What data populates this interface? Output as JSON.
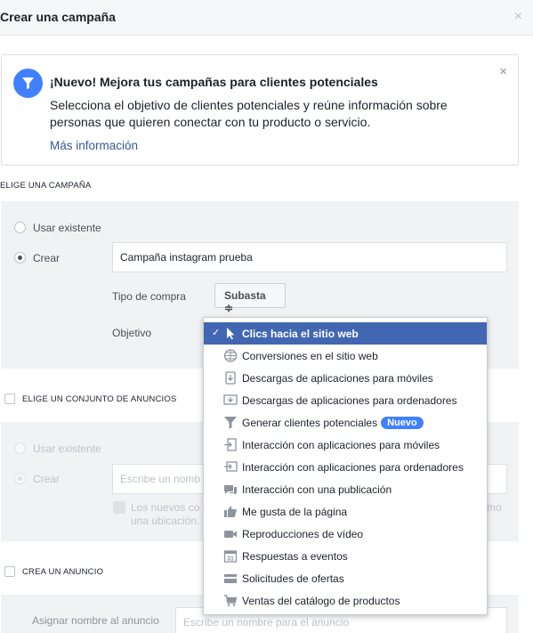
{
  "header": {
    "title": "Crear una campaña",
    "close_glyph": "×"
  },
  "notice": {
    "icon": "filter-icon",
    "title": "¡Nuevo! Mejora tus campañas para clientes potenciales",
    "body_line1": "Selecciona el objetivo de clientes potenciales y reúne información sobre",
    "body_line2": "personas que quieren conectar con tu producto o servicio.",
    "link": "Más información",
    "close_glyph": "×"
  },
  "campaign": {
    "section_label": "ELIGE UNA CAMPAÑA",
    "use_existing": "Usar existente",
    "create": "Crear",
    "name_value": "Campaña instagram prueba",
    "purchase_type_label": "Tipo de compra",
    "purchase_type_value": "Subasta ≑",
    "objective_label": "Objetivo"
  },
  "adset": {
    "section_label": "ELIGE UN CONJUNTO DE ANUNCIOS",
    "use_existing": "Usar existente",
    "create": "Crear",
    "name_placeholder": "Escribe un nomb",
    "note_line1": "Los nuevos co",
    "note_line2": "una ubicación.",
    "note_right": "mo"
  },
  "ad": {
    "section_label": "CREA UN ANUNCIO",
    "name_label": "Asignar nombre al anuncio",
    "name_placeholder": "Escribe un nombre para el anuncio"
  },
  "objective_menu": {
    "selected_glyph": "✓",
    "items": [
      {
        "label": "Clics hacia el sitio web",
        "icon": "cursor-icon",
        "selected": true
      },
      {
        "label": "Conversiones en el sitio web",
        "icon": "globe-icon"
      },
      {
        "label": "Descargas de aplicaciones para móviles",
        "icon": "download-mobile-icon"
      },
      {
        "label": "Descargas de aplicaciones para ordenadores",
        "icon": "download-desktop-icon"
      },
      {
        "label": "Generar clientes potenciales",
        "icon": "filter-icon",
        "badge": "Nuevo"
      },
      {
        "label": "Interacción con aplicaciones para móviles",
        "icon": "app-engage-mobile-icon"
      },
      {
        "label": "Interacción con aplicaciones para ordenadores",
        "icon": "app-engage-desktop-icon"
      },
      {
        "label": "Interacción con una publicación",
        "icon": "post-engagement-icon"
      },
      {
        "label": "Me gusta de la página",
        "icon": "thumbs-up-icon"
      },
      {
        "label": "Reproducciones de vídeo",
        "icon": "video-camera-icon"
      },
      {
        "label": "Respuestas a eventos",
        "icon": "calendar-icon"
      },
      {
        "label": "Solicitudes de ofertas",
        "icon": "offer-icon"
      },
      {
        "label": "Ventas del catálogo de productos",
        "icon": "cart-icon"
      }
    ]
  },
  "colors": {
    "accent": "#4267b2",
    "link": "#365899",
    "badge": "#4080ff",
    "panel": "#f1f2f4"
  }
}
